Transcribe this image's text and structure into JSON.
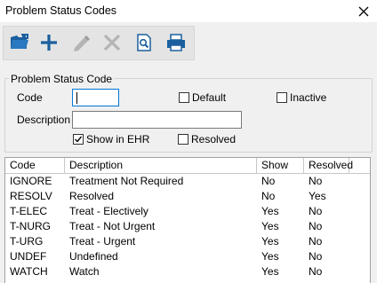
{
  "window": {
    "title": "Problem Status Codes"
  },
  "icons": {
    "close": "close-icon",
    "toolbar": [
      "open-icon",
      "add-icon",
      "edit-icon",
      "delete-icon",
      "preview-icon",
      "print-icon"
    ]
  },
  "form": {
    "group_title": "Problem Status Code",
    "code_label": "Code",
    "code_value": "",
    "description_label": "Description",
    "description_value": "",
    "default_label": "Default",
    "default_checked": false,
    "inactive_label": "Inactive",
    "inactive_checked": false,
    "show_in_ehr_label": "Show in EHR",
    "show_in_ehr_checked": true,
    "resolved_label": "Resolved",
    "resolved_checked": false
  },
  "grid": {
    "columns": [
      "Code",
      "Description",
      "Show",
      "Resolved"
    ],
    "rows": [
      [
        "IGNORE",
        "Treatment Not Required",
        "No",
        "No"
      ],
      [
        "RESOLV",
        "Resolved",
        "No",
        "Yes"
      ],
      [
        "T-ELEC",
        "Treat - Electively",
        "Yes",
        "No"
      ],
      [
        "T-NURG",
        "Treat - Not Urgent",
        "Yes",
        "No"
      ],
      [
        "T-URG",
        "Treat - Urgent",
        "Yes",
        "No"
      ],
      [
        "UNDEF",
        "Undefined",
        "Yes",
        "No"
      ],
      [
        "WATCH",
        "Watch",
        "Yes",
        "No"
      ]
    ]
  }
}
